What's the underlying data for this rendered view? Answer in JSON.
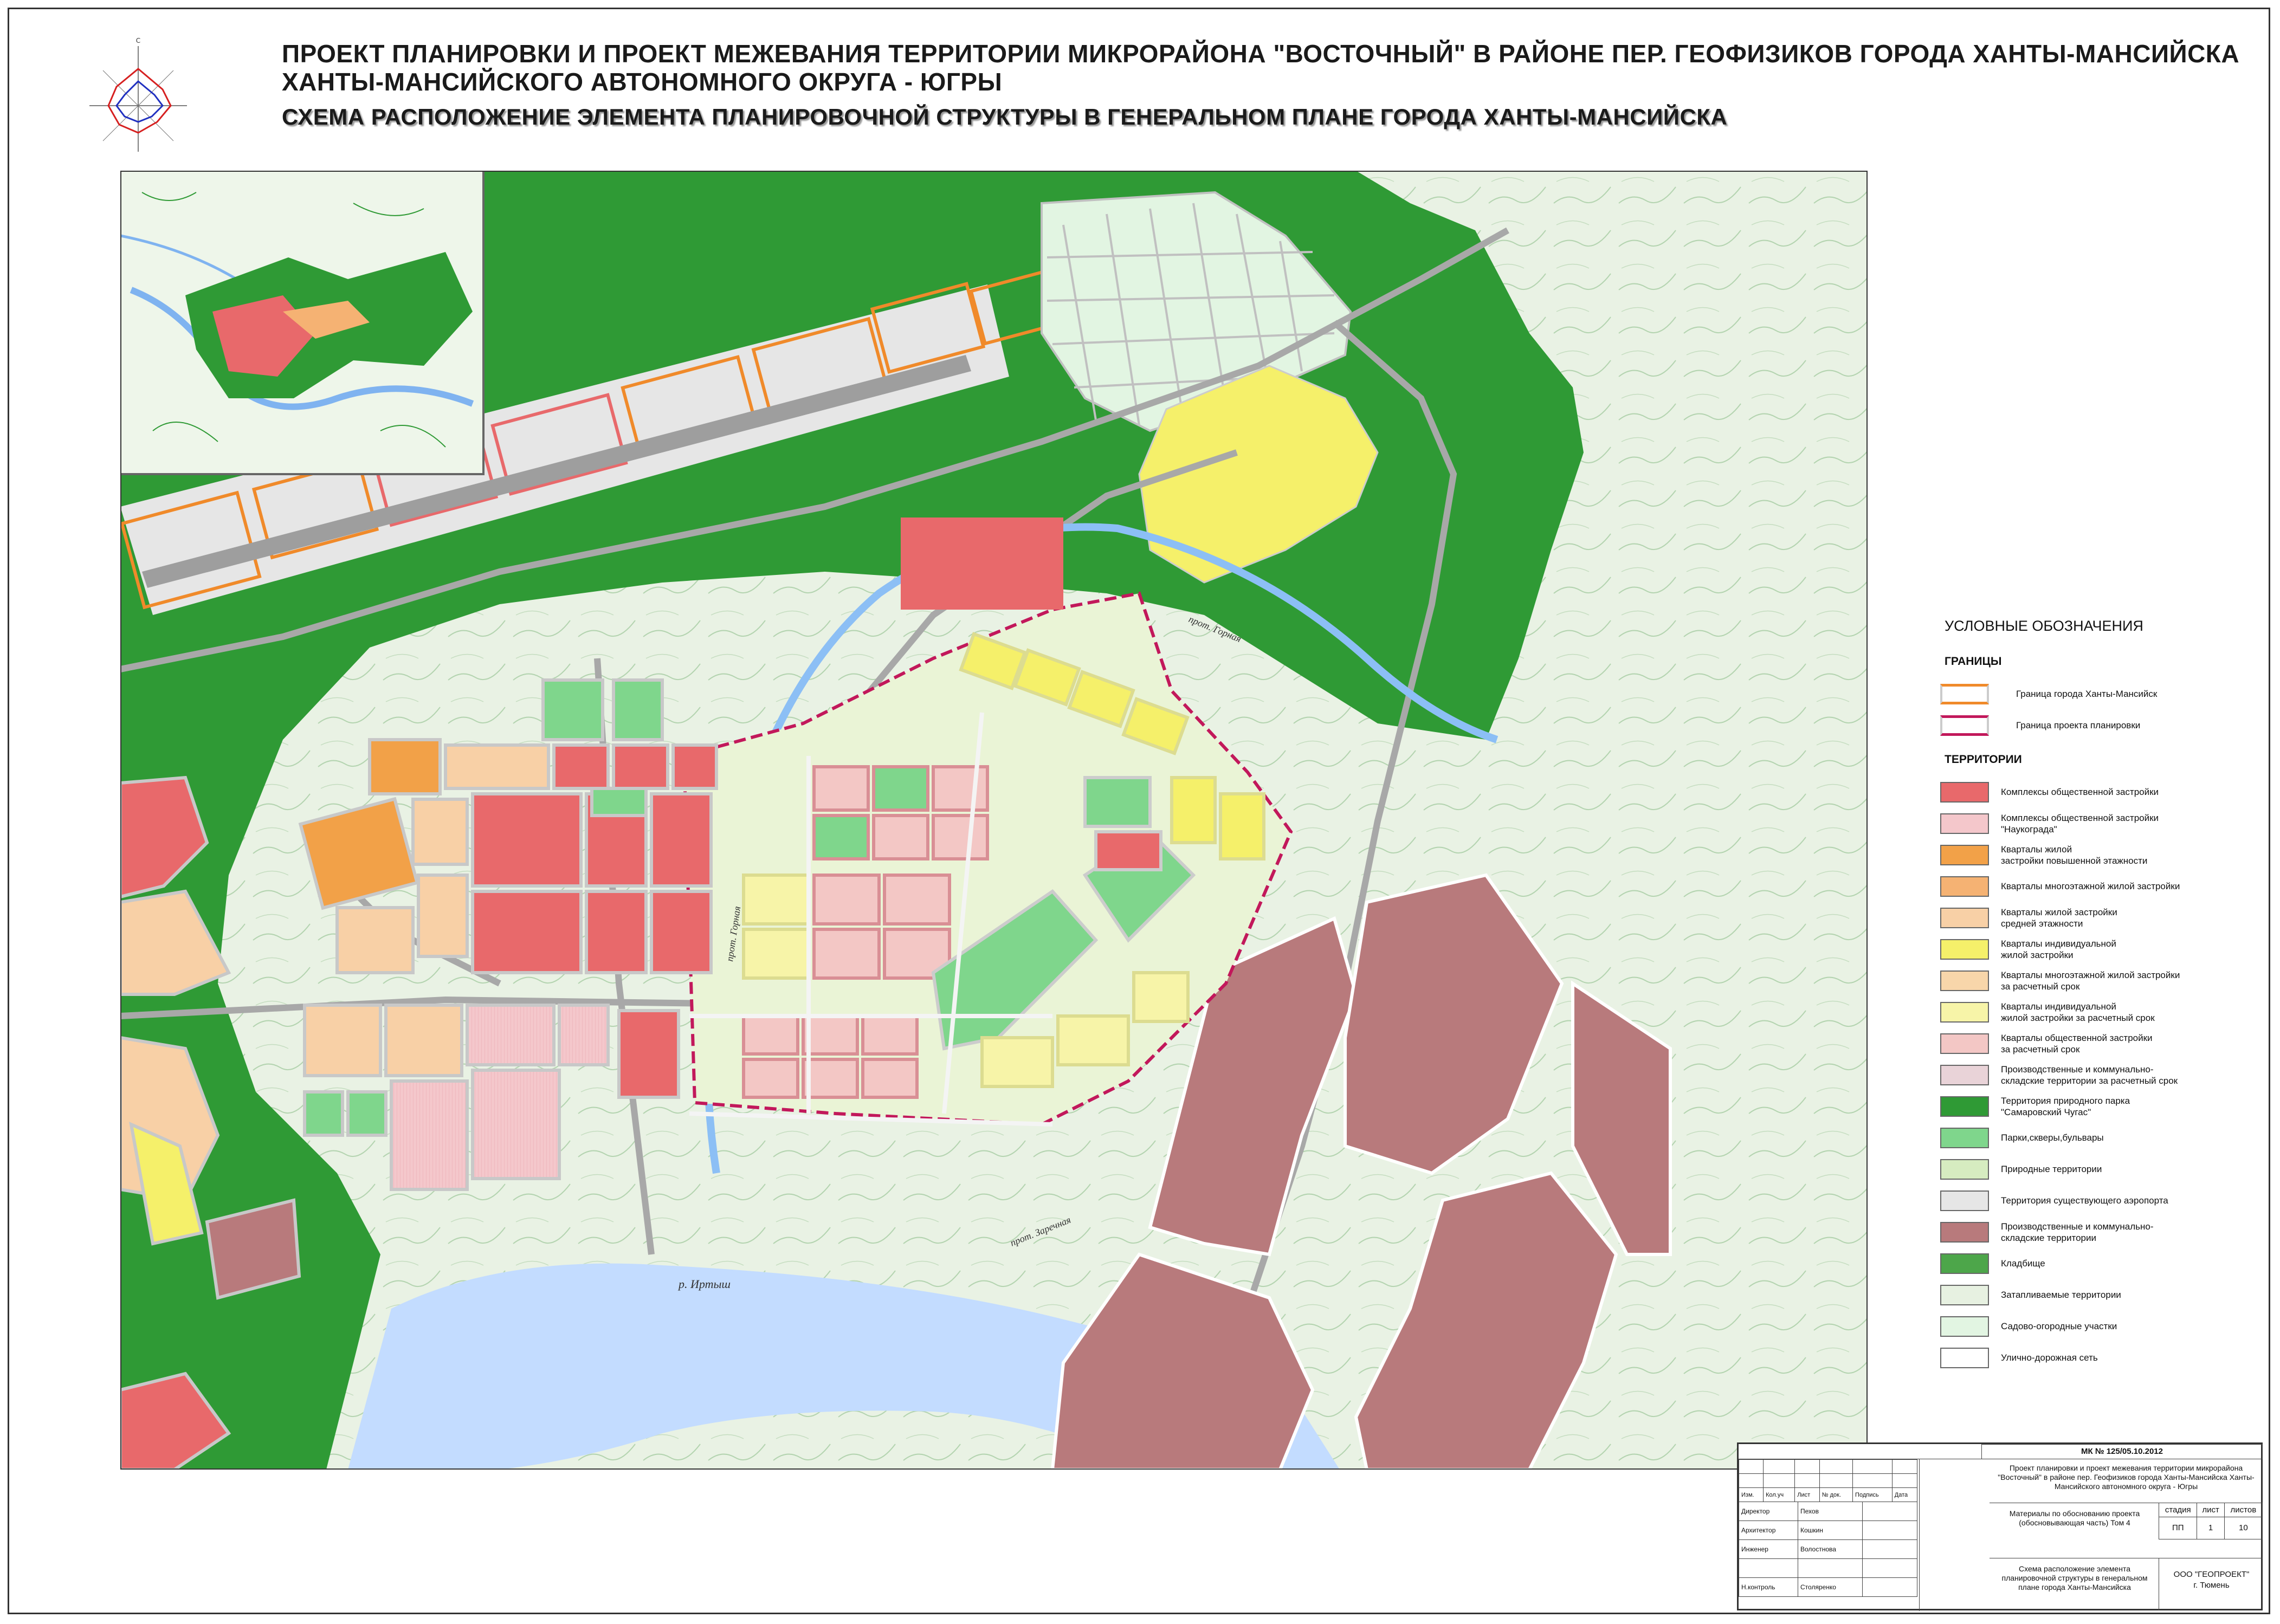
{
  "title": {
    "line1": "ПРОЕКТ ПЛАНИРОВКИ И ПРОЕКТ МЕЖЕВАНИЯ ТЕРРИТОРИИ МИКРОРАЙОНА \"ВОСТОЧНЫЙ\" В РАЙОНЕ ПЕР. ГЕОФИЗИКОВ ГОРОДА ХАНТЫ-МАНСИЙСКА",
    "line2": "ХАНТЫ-МАНСИЙСКОГО АВТОНОМНОГО ОКРУГА - ЮГРЫ",
    "line3": "СХЕМА РАСПОЛОЖЕНИЕ ЭЛЕМЕНТА ПЛАНИРОВОЧНОЙ СТРУКТУРЫ В ГЕНЕРАЛЬНОМ ПЛАНЕ ГОРОДА ХАНТЫ-МАНСИЙСКА"
  },
  "map_labels": {
    "river_irtysh": "р. Иртыш",
    "channel_gornaya": "прот. Горная",
    "channel_gornaya2": "прот. Горная",
    "channel_zarechnaya": "прот. Заречная"
  },
  "legend": {
    "title": "УСЛОВНЫЕ ОБОЗНАЧЕНИЯ",
    "section_borders": "ГРАНИЦЫ",
    "section_territories": "ТЕРРИТОРИИ",
    "borders": [
      {
        "label": "Граница города Ханты-Мансийск",
        "color": "#f08a2a"
      },
      {
        "label": "Граница проекта планировки",
        "color": "#c2185b"
      }
    ],
    "items": [
      {
        "label": "Комплексы общественной застройки",
        "fill": "#e8696b"
      },
      {
        "label": "Комплексы общественной застройки\n\"Наукограда\"",
        "fill": "#f4c7cb"
      },
      {
        "label": "Кварталы жилой\nзастройки повышенной этажности",
        "fill": "#f2a148"
      },
      {
        "label": "Кварталы многоэтажной жилой застройки",
        "fill": "#f5b273"
      },
      {
        "label": "Кварталы жилой застройки\nсредней этажности",
        "fill": "#f8d0a6"
      },
      {
        "label": "Кварталы индивидуальной\nжилой застройки",
        "fill": "#f5f06a"
      },
      {
        "label": "Кварталы многоэтажной жилой застройки\nза расчетный срок",
        "fill": "#f8d6aa"
      },
      {
        "label": "Кварталы индивидуальной\nжилой застройки за расчетный срок",
        "fill": "#f7f4a8"
      },
      {
        "label": "Кварталы общественной застройки\nза расчетный срок",
        "fill": "#f3c7c5"
      },
      {
        "label": "Производственные и коммунально-\nскладские территории за расчетный срок",
        "fill": "#e9d3d8"
      },
      {
        "label": "Территория природного парка\n\"Самаровский Чугас\"",
        "fill": "#2f9a35"
      },
      {
        "label": "Парки,скверы,бульвары",
        "fill": "#7fd68c"
      },
      {
        "label": "Природные территории",
        "fill": "#d6ecc0"
      },
      {
        "label": "Территория существующего аэропорта",
        "fill": "#e6e6e6"
      },
      {
        "label": "Производственные и коммунально-\nскладские территории",
        "fill": "#b87a7c"
      },
      {
        "label": "Кладбище",
        "fill": "#4da64a"
      },
      {
        "label": "Затапливаемые  территории",
        "fill": "#e7f1e1"
      },
      {
        "label": "Садово-огородные участки",
        "fill": "#e2f5e2"
      },
      {
        "label": "Улично-дорожная сеть",
        "fill": "#ffffff"
      }
    ]
  },
  "stamp": {
    "code": "МК № 125/05.10.2012",
    "project": "Проект планировки и проект межевания территории микрорайона \"Восточный\" в районе пер. Геофизиков города Ханты-Мансийска Ханты-Мансийского автономного округа - Югры",
    "headers": [
      "Изм.",
      "Кол.уч",
      "Лист",
      "№ док.",
      "Подпись",
      "Дата"
    ],
    "roles": [
      {
        "role": "Директор",
        "name": "Пехов"
      },
      {
        "role": "Архитектор",
        "name": "Кошкин"
      },
      {
        "role": "Инженер",
        "name": "Волостнова"
      },
      {
        "role": "",
        "name": ""
      },
      {
        "role": "Н.контроль",
        "name": "Столяренко"
      }
    ],
    "volume": "Материалы по обоснованию проекта (обосновывающая часть) Том 4",
    "stage_header": "стадия",
    "sheet_header": "лист",
    "sheets_header": "листов",
    "stage": "ПП",
    "sheet": "1",
    "sheets": "10",
    "drawing": "Схема расположение элемента планировочной структуры в генеральном плане города Ханты-Мансийска",
    "org": "ООО \"ГЕОПРОЕКТ\"",
    "city": "г. Тюмень"
  }
}
